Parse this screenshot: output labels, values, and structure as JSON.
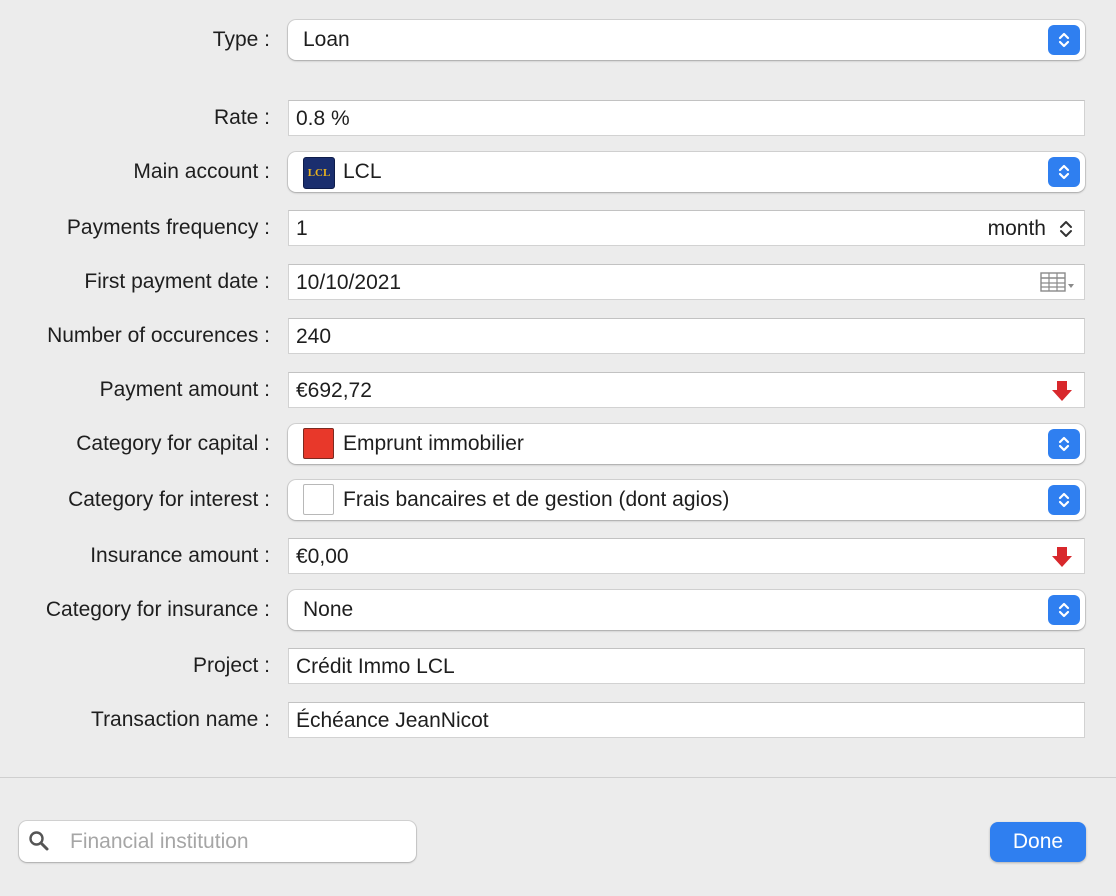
{
  "form": {
    "type": {
      "label": "Type :",
      "value": "Loan"
    },
    "rate": {
      "label": "Rate :",
      "value": "0.8 %"
    },
    "main_account": {
      "label": "Main account :",
      "value": "LCL",
      "logo_text": "LCL"
    },
    "payments_frequency": {
      "label": "Payments frequency :",
      "value": "1",
      "unit": "month"
    },
    "first_payment_date": {
      "label": "First payment date :",
      "value": "10/10/2021"
    },
    "number_of_occurences": {
      "label": "Number of occurences :",
      "value": "240"
    },
    "payment_amount": {
      "label": "Payment amount :",
      "value": "€692,72"
    },
    "category_capital": {
      "label": "Category for capital :",
      "value": "Emprunt immobilier",
      "swatch_color": "#e8382a"
    },
    "category_interest": {
      "label": "Category for interest :",
      "value": "Frais bancaires et de gestion (dont agios)",
      "swatch_color": "#ffffff"
    },
    "insurance_amount": {
      "label": "Insurance amount :",
      "value": "€0,00"
    },
    "category_insurance": {
      "label": "Category for insurance :",
      "value": "None"
    },
    "project": {
      "label": "Project :",
      "value": "Crédit Immo LCL"
    },
    "transaction_name": {
      "label": "Transaction name :",
      "value": "Échéance JeanNicot"
    }
  },
  "footer": {
    "search_placeholder": "Financial institution",
    "done_label": "Done"
  },
  "colors": {
    "accent": "#2f7ff0",
    "expense_arrow": "#d8282c",
    "background": "#ececec"
  },
  "icons": {
    "stepper": "up-down-chevron-icon",
    "calendar": "calendar-grid-icon",
    "expense": "red-down-arrow-icon",
    "search": "magnifier-icon"
  }
}
